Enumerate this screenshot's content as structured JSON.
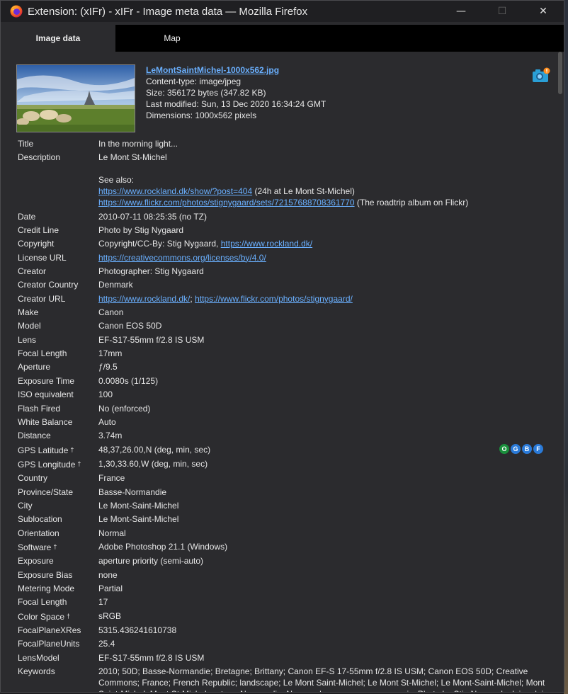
{
  "window": {
    "title": "Extension: (xIFr) - xIFr - Image meta data — Mozilla Firefox",
    "minimize_glyph": "—",
    "maximize_glyph": "☐",
    "close_glyph": "✕"
  },
  "tabs": [
    {
      "label": "Image data",
      "active": true
    },
    {
      "label": "Map",
      "active": false
    }
  ],
  "file": {
    "name": "LeMontSaintMichel-1000x562.jpg",
    "content_type": "Content-type: image/jpeg",
    "size": "Size: 356172 bytes (347.82 KB)",
    "modified": "Last modified: Sun, 13 Dec 2020 16:34:24 GMT",
    "dimensions": "Dimensions: 1000x562 pixels"
  },
  "icons": {
    "app": "firefox-icon",
    "camera": "camera-icon",
    "gps_services": [
      "O",
      "G",
      "B",
      "F"
    ],
    "gps_colors": [
      "#1a8f3c",
      "#2a7ad8",
      "#2a7ad8",
      "#2a7ad8"
    ]
  },
  "meta": {
    "title_label": "Title",
    "title_value": "In the morning light...",
    "description_label": "Description",
    "description_line1": "Le Mont St-Michel",
    "description_see": "See also:",
    "description_link1": "https://www.rockland.dk/show/?post=404",
    "description_link1_note": " (24h at Le Mont St-Michel)",
    "description_link2": "https://www.flickr.com/photos/stignygaard/sets/72157688708361770",
    "description_link2_note": " (The roadtrip album on Flickr)",
    "date_label": "Date",
    "date_value": "2010-07-11 08:25:35 (no TZ)",
    "credit_label": "Credit Line",
    "credit_value": "Photo by Stig Nygaard",
    "copyright_label": "Copyright",
    "copyright_text": "Copyright/CC-By: Stig Nygaard, ",
    "copyright_link": "https://www.rockland.dk/",
    "license_label": "License URL",
    "license_link": "https://creativecommons.org/licenses/by/4.0/",
    "creator_label": "Creator",
    "creator_value": "Photographer: Stig Nygaard",
    "creator_country_label": "Creator Country",
    "creator_country_value": "Denmark",
    "creator_url_label": "Creator URL",
    "creator_url_link1": "https://www.rockland.dk/",
    "creator_url_sep": "; ",
    "creator_url_link2": "https://www.flickr.com/photos/stignygaard/",
    "make_label": "Make",
    "make_value": "Canon",
    "model_label": "Model",
    "model_value": "Canon EOS 50D",
    "lens_label": "Lens",
    "lens_value": "EF-S17-55mm f/2.8 IS USM",
    "focal_label": "Focal Length",
    "focal_value": "17mm",
    "aperture_label": "Aperture",
    "aperture_value": "ƒ/9.5",
    "exposure_time_label": "Exposure Time",
    "exposure_time_value": "0.0080s (1/125)",
    "iso_label": "ISO equivalent",
    "iso_value": "100",
    "flash_label": "Flash Fired",
    "flash_value": "No (enforced)",
    "wb_label": "White Balance",
    "wb_value": "Auto",
    "distance_label": "Distance",
    "distance_value": "3.74m",
    "gps_lat_label": "GPS Latitude",
    "gps_lat_value": "48,37,26.00,N (deg, min, sec)",
    "gps_lon_label": "GPS Longitude",
    "gps_lon_value": "1,30,33.60,W (deg, min, sec)",
    "country_label": "Country",
    "country_value": "France",
    "province_label": "Province/State",
    "province_value": "Basse-Normandie",
    "city_label": "City",
    "city_value": "Le Mont-Saint-Michel",
    "sublocation_label": "Sublocation",
    "sublocation_value": "Le Mont-Saint-Michel",
    "orientation_label": "Orientation",
    "orientation_value": "Normal",
    "software_label": "Software",
    "software_value": "Adobe Photoshop 21.1 (Windows)",
    "exposure_label": "Exposure",
    "exposure_value": "aperture priority (semi-auto)",
    "bias_label": "Exposure Bias",
    "bias_value": "none",
    "metering_label": "Metering Mode",
    "metering_value": "Partial",
    "focal2_label": "Focal Length",
    "focal2_value": "17",
    "colorspace_label": "Color Space",
    "colorspace_value": "sRGB",
    "fpx_label": "FocalPlaneXRes",
    "fpx_value": "5315.436241610738",
    "fpu_label": "FocalPlaneUnits",
    "fpu_value": "25.4",
    "lensmodel_label": "LensModel",
    "lensmodel_value": "EF-S17-55mm f/2.8 IS USM",
    "keywords_label": "Keywords",
    "keywords_value": "2010; 50D; Basse-Normandie; Bretagne; Brittany; Canon EF-S 17-55mm f/2.8 IS USM; Canon EOS 50D; Creative Commons; France; French Republic; landscape; Le Mont Saint-Michel; Le Mont St-Michel; Le Mont-Saint-Michel; Mont Saint-Michel; Mont St-Michel; nature; Normandie; Normandy; panorama; panoramic; Photo by Stig Nygaard; plain; plains; road trip;",
    "dagger": "†"
  }
}
